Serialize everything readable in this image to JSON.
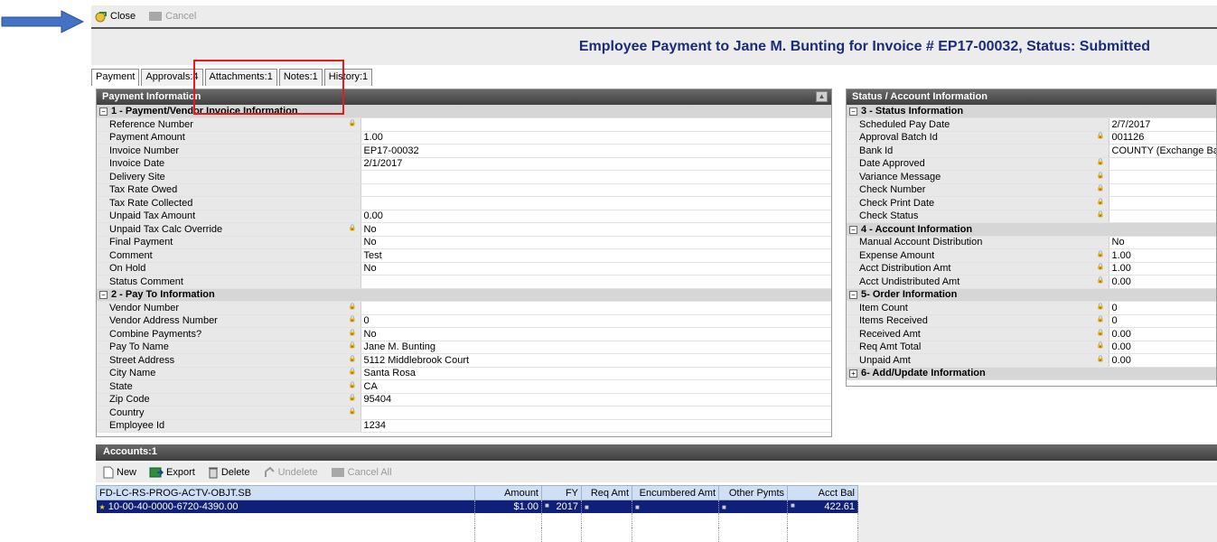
{
  "toolbar": {
    "close_label": "Close",
    "cancel_label": "Cancel"
  },
  "header": {
    "title": "Employee Payment to Jane M. Bunting for Invoice # EP17-00032, Status: Submitted"
  },
  "tabs": [
    {
      "label": "Payment"
    },
    {
      "label": "Approvals:4"
    },
    {
      "label": "Attachments:1"
    },
    {
      "label": "Notes:1"
    },
    {
      "label": "History:1"
    }
  ],
  "payment_panel": {
    "title": "Payment Information",
    "sec1": "1 - Payment/Vendor Invoice Information",
    "sec1_rows": [
      {
        "label": "Reference Number",
        "value": ""
      },
      {
        "label": "Payment Amount",
        "value": "1.00"
      },
      {
        "label": "Invoice Number",
        "value": "EP17-00032"
      },
      {
        "label": "Invoice Date",
        "value": "2/1/2017"
      },
      {
        "label": "Delivery Site",
        "value": ""
      },
      {
        "label": "Tax Rate Owed",
        "value": ""
      },
      {
        "label": "Tax Rate Collected",
        "value": ""
      },
      {
        "label": "Unpaid Tax Amount",
        "value": "0.00"
      },
      {
        "label": "Unpaid Tax Calc Override",
        "value": "No"
      },
      {
        "label": "Final Payment",
        "value": "No"
      },
      {
        "label": "Comment",
        "value": "Test"
      },
      {
        "label": "On Hold",
        "value": "No"
      },
      {
        "label": "Status Comment",
        "value": ""
      }
    ],
    "sec2": "2 - Pay To Information",
    "sec2_rows": [
      {
        "label": "Vendor Number",
        "value": ""
      },
      {
        "label": "Vendor Address Number",
        "value": "0"
      },
      {
        "label": "Combine Payments?",
        "value": "No"
      },
      {
        "label": "Pay To Name",
        "value": "Jane M. Bunting"
      },
      {
        "label": "Street Address",
        "value": "5112 Middlebrook Court"
      },
      {
        "label": "City Name",
        "value": "Santa Rosa"
      },
      {
        "label": "State",
        "value": "CA"
      },
      {
        "label": "Zip Code",
        "value": "95404"
      },
      {
        "label": "Country",
        "value": ""
      },
      {
        "label": "Employee Id",
        "value": "1234"
      }
    ]
  },
  "status_panel": {
    "title": "Status / Account Information",
    "sec3": "3 - Status Information",
    "sec3_rows": [
      {
        "label": "Scheduled Pay Date",
        "value": "2/7/2017"
      },
      {
        "label": "Approval Batch Id",
        "value": "001126"
      },
      {
        "label": "Bank Id",
        "value": "COUNTY (Exchange Ba"
      },
      {
        "label": "Date Approved",
        "value": ""
      },
      {
        "label": "Variance Message",
        "value": ""
      },
      {
        "label": "Check Number",
        "value": ""
      },
      {
        "label": "Check Print Date",
        "value": ""
      },
      {
        "label": "Check Status",
        "value": ""
      }
    ],
    "sec4": "4 - Account Information",
    "sec4_rows": [
      {
        "label": "Manual Account Distribution",
        "value": "No"
      },
      {
        "label": "Expense Amount",
        "value": "1.00"
      },
      {
        "label": "Acct Distribution Amt",
        "value": "1.00"
      },
      {
        "label": "Acct Undistributed Amt",
        "value": "0.00"
      }
    ],
    "sec5": "5- Order Information",
    "sec5_rows": [
      {
        "label": "Item Count",
        "value": "0"
      },
      {
        "label": "Items Received",
        "value": "0"
      },
      {
        "label": "Received Amt",
        "value": "0.00"
      },
      {
        "label": "Req Amt Total",
        "value": "0.00"
      },
      {
        "label": "Unpaid Amt",
        "value": "0.00"
      }
    ],
    "sec6": "6- Add/Update Information"
  },
  "accounts": {
    "title": "Accounts:1",
    "toolbar": {
      "new": "New",
      "export": "Export",
      "delete": "Delete",
      "undelete": "Undelete",
      "cancel_all": "Cancel All"
    },
    "columns": [
      "FD-LC-RS-PROG-ACTV-OBJT.SB",
      "Amount",
      "FY",
      "Req Amt",
      "Encumbered Amt",
      "Other Pymts",
      "Acct Bal"
    ],
    "row": {
      "account": "10-00-40-0000-6720-4390.00",
      "amount": "$1.00",
      "fy": "2017",
      "req_amt": "",
      "encumbered": "",
      "other": "",
      "acct_bal": "422.61"
    }
  },
  "colors": {
    "title_blue": "#1a2b78",
    "highlight_red": "#e31b1b",
    "arrow_blue": "#4472c4",
    "selected_row": "#10207a"
  }
}
